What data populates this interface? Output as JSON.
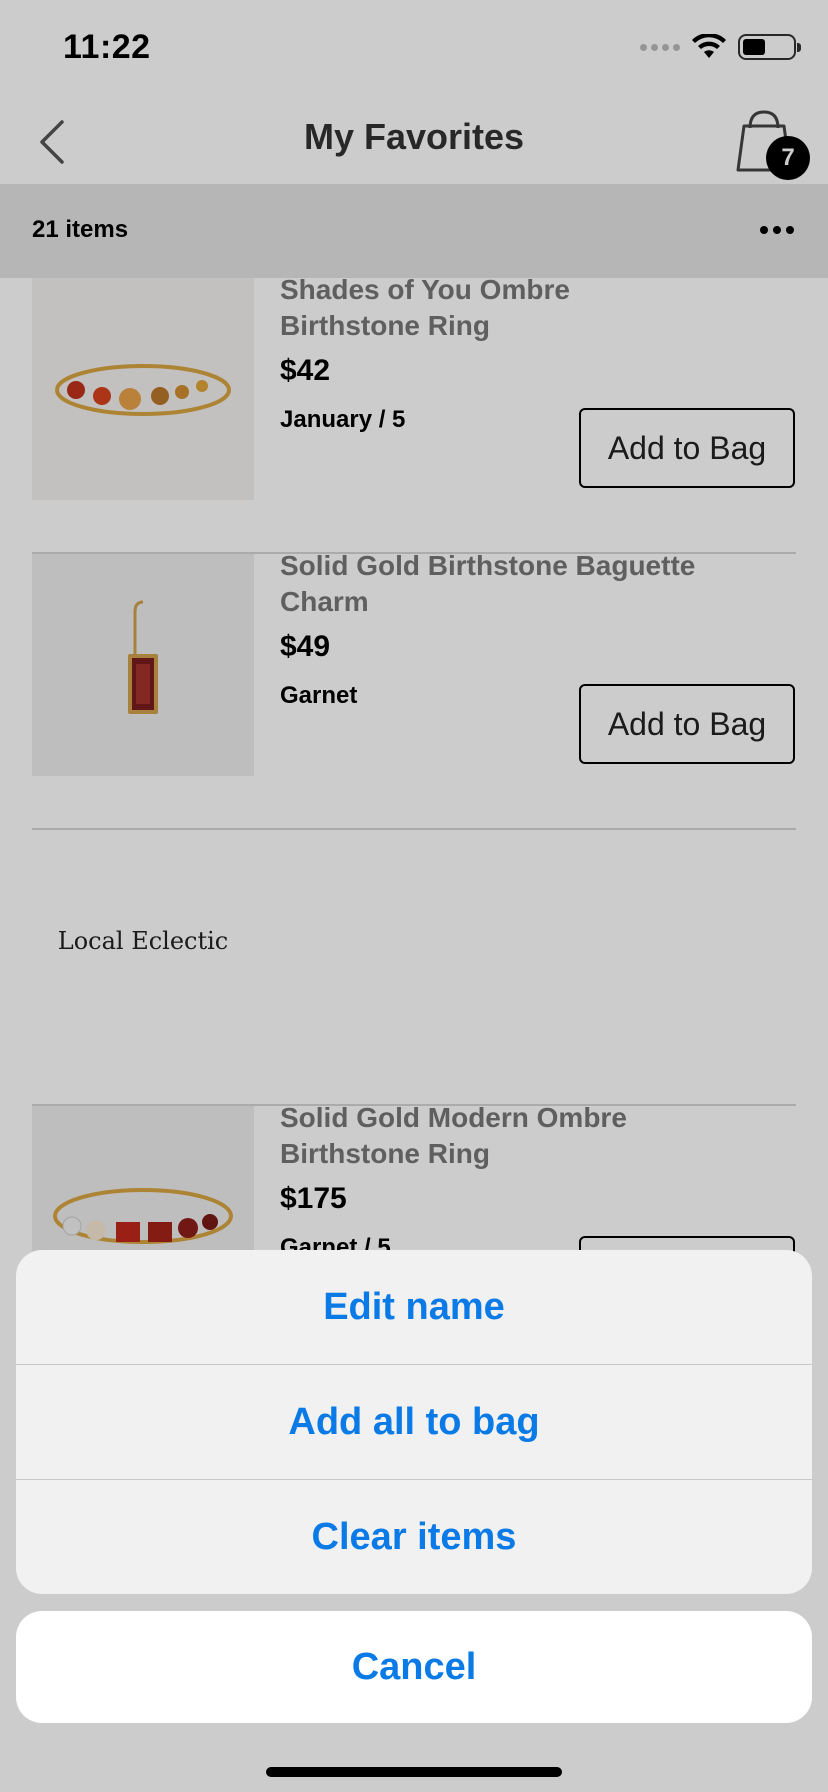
{
  "status_bar": {
    "time": "11:22"
  },
  "nav": {
    "title": "My Favorites",
    "bag_count": "7"
  },
  "list_header": {
    "count": "21 items"
  },
  "items": [
    {
      "name": "Shades of You Ombre Birthstone Ring",
      "price": "$42",
      "variant": "January / 5",
      "button": "Add to Bag"
    },
    {
      "name": "Solid Gold Birthstone Baguette Charm",
      "price": "$49",
      "variant": "Garnet",
      "button": "Add to Bag"
    },
    {
      "brand_logo": "Local Eclectic"
    },
    {
      "name": "Solid Gold Modern Ombre Birthstone Ring",
      "price": "$175",
      "variant": "Garnet / 5",
      "button": "Add to Bag"
    }
  ],
  "action_sheet": {
    "options": [
      "Edit name",
      "Add all to bag",
      "Clear items"
    ],
    "cancel": "Cancel"
  },
  "colors": {
    "action_blue": "#0a7ae6",
    "badge": "#000000",
    "list_header_bg": "#e4e4e4"
  }
}
